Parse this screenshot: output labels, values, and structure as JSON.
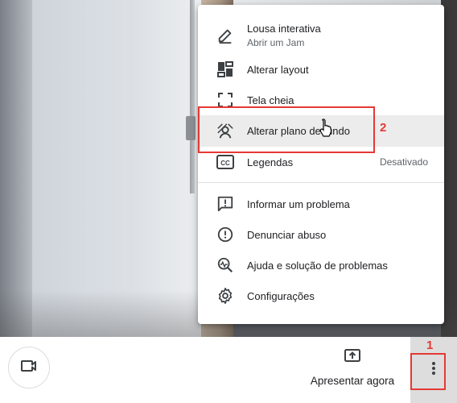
{
  "menu": {
    "items": [
      {
        "label": "Lousa interativa",
        "sublabel": "Abrir um Jam",
        "icon": "pencil-icon"
      },
      {
        "label": "Alterar layout",
        "icon": "layout-icon"
      },
      {
        "label": "Tela cheia",
        "icon": "fullscreen-icon"
      },
      {
        "label": "Alterar plano de fundo",
        "icon": "change-background-icon"
      },
      {
        "label": "Legendas",
        "value": "Desativado",
        "icon": "closed-captions-icon"
      },
      {
        "label": "Informar um problema",
        "icon": "report-problem-icon"
      },
      {
        "label": "Denunciar abuso",
        "icon": "report-abuse-icon"
      },
      {
        "label": "Ajuda e solução de problemas",
        "icon": "help-troubleshoot-icon"
      },
      {
        "label": "Configurações",
        "icon": "gear-icon"
      }
    ]
  },
  "bottom_bar": {
    "present_label": "Apresentar agora",
    "camera_icon": "camera-icon",
    "present_icon": "present-screen-icon",
    "more_icon": "more-vertical-icon"
  },
  "annotations": {
    "step1": "1",
    "step2": "2",
    "color": "#e53935"
  },
  "colors": {
    "highlight": "#ececec",
    "text": "#202124",
    "secondary_text": "#5f6368"
  }
}
